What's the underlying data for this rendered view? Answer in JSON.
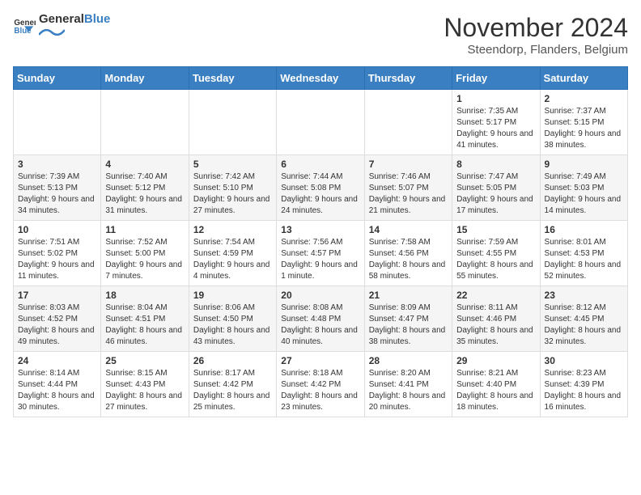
{
  "logo": {
    "general": "General",
    "blue": "Blue"
  },
  "title": "November 2024",
  "subtitle": "Steendorp, Flanders, Belgium",
  "days_of_week": [
    "Sunday",
    "Monday",
    "Tuesday",
    "Wednesday",
    "Thursday",
    "Friday",
    "Saturday"
  ],
  "weeks": [
    [
      {
        "day": "",
        "info": ""
      },
      {
        "day": "",
        "info": ""
      },
      {
        "day": "",
        "info": ""
      },
      {
        "day": "",
        "info": ""
      },
      {
        "day": "",
        "info": ""
      },
      {
        "day": "1",
        "info": "Sunrise: 7:35 AM\nSunset: 5:17 PM\nDaylight: 9 hours and 41 minutes."
      },
      {
        "day": "2",
        "info": "Sunrise: 7:37 AM\nSunset: 5:15 PM\nDaylight: 9 hours and 38 minutes."
      }
    ],
    [
      {
        "day": "3",
        "info": "Sunrise: 7:39 AM\nSunset: 5:13 PM\nDaylight: 9 hours and 34 minutes."
      },
      {
        "day": "4",
        "info": "Sunrise: 7:40 AM\nSunset: 5:12 PM\nDaylight: 9 hours and 31 minutes."
      },
      {
        "day": "5",
        "info": "Sunrise: 7:42 AM\nSunset: 5:10 PM\nDaylight: 9 hours and 27 minutes."
      },
      {
        "day": "6",
        "info": "Sunrise: 7:44 AM\nSunset: 5:08 PM\nDaylight: 9 hours and 24 minutes."
      },
      {
        "day": "7",
        "info": "Sunrise: 7:46 AM\nSunset: 5:07 PM\nDaylight: 9 hours and 21 minutes."
      },
      {
        "day": "8",
        "info": "Sunrise: 7:47 AM\nSunset: 5:05 PM\nDaylight: 9 hours and 17 minutes."
      },
      {
        "day": "9",
        "info": "Sunrise: 7:49 AM\nSunset: 5:03 PM\nDaylight: 9 hours and 14 minutes."
      }
    ],
    [
      {
        "day": "10",
        "info": "Sunrise: 7:51 AM\nSunset: 5:02 PM\nDaylight: 9 hours and 11 minutes."
      },
      {
        "day": "11",
        "info": "Sunrise: 7:52 AM\nSunset: 5:00 PM\nDaylight: 9 hours and 7 minutes."
      },
      {
        "day": "12",
        "info": "Sunrise: 7:54 AM\nSunset: 4:59 PM\nDaylight: 9 hours and 4 minutes."
      },
      {
        "day": "13",
        "info": "Sunrise: 7:56 AM\nSunset: 4:57 PM\nDaylight: 9 hours and 1 minute."
      },
      {
        "day": "14",
        "info": "Sunrise: 7:58 AM\nSunset: 4:56 PM\nDaylight: 8 hours and 58 minutes."
      },
      {
        "day": "15",
        "info": "Sunrise: 7:59 AM\nSunset: 4:55 PM\nDaylight: 8 hours and 55 minutes."
      },
      {
        "day": "16",
        "info": "Sunrise: 8:01 AM\nSunset: 4:53 PM\nDaylight: 8 hours and 52 minutes."
      }
    ],
    [
      {
        "day": "17",
        "info": "Sunrise: 8:03 AM\nSunset: 4:52 PM\nDaylight: 8 hours and 49 minutes."
      },
      {
        "day": "18",
        "info": "Sunrise: 8:04 AM\nSunset: 4:51 PM\nDaylight: 8 hours and 46 minutes."
      },
      {
        "day": "19",
        "info": "Sunrise: 8:06 AM\nSunset: 4:50 PM\nDaylight: 8 hours and 43 minutes."
      },
      {
        "day": "20",
        "info": "Sunrise: 8:08 AM\nSunset: 4:48 PM\nDaylight: 8 hours and 40 minutes."
      },
      {
        "day": "21",
        "info": "Sunrise: 8:09 AM\nSunset: 4:47 PM\nDaylight: 8 hours and 38 minutes."
      },
      {
        "day": "22",
        "info": "Sunrise: 8:11 AM\nSunset: 4:46 PM\nDaylight: 8 hours and 35 minutes."
      },
      {
        "day": "23",
        "info": "Sunrise: 8:12 AM\nSunset: 4:45 PM\nDaylight: 8 hours and 32 minutes."
      }
    ],
    [
      {
        "day": "24",
        "info": "Sunrise: 8:14 AM\nSunset: 4:44 PM\nDaylight: 8 hours and 30 minutes."
      },
      {
        "day": "25",
        "info": "Sunrise: 8:15 AM\nSunset: 4:43 PM\nDaylight: 8 hours and 27 minutes."
      },
      {
        "day": "26",
        "info": "Sunrise: 8:17 AM\nSunset: 4:42 PM\nDaylight: 8 hours and 25 minutes."
      },
      {
        "day": "27",
        "info": "Sunrise: 8:18 AM\nSunset: 4:42 PM\nDaylight: 8 hours and 23 minutes."
      },
      {
        "day": "28",
        "info": "Sunrise: 8:20 AM\nSunset: 4:41 PM\nDaylight: 8 hours and 20 minutes."
      },
      {
        "day": "29",
        "info": "Sunrise: 8:21 AM\nSunset: 4:40 PM\nDaylight: 8 hours and 18 minutes."
      },
      {
        "day": "30",
        "info": "Sunrise: 8:23 AM\nSunset: 4:39 PM\nDaylight: 8 hours and 16 minutes."
      }
    ]
  ]
}
